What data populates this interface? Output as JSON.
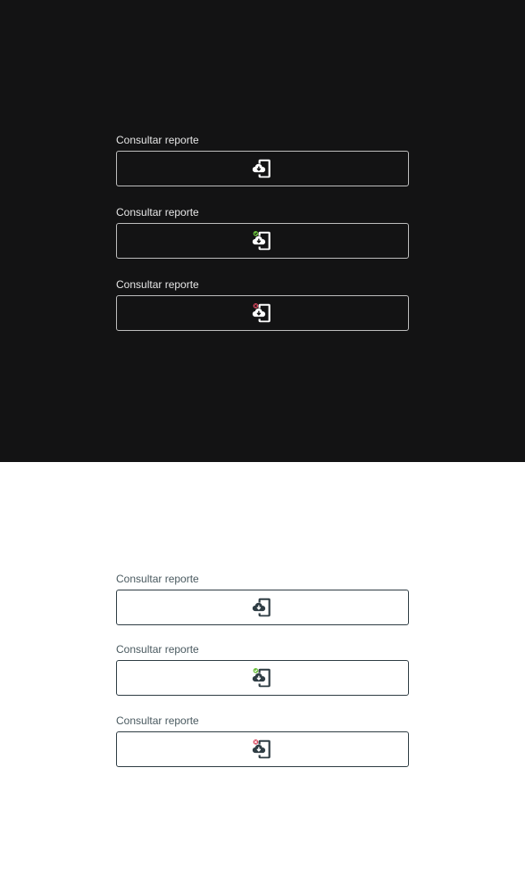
{
  "colors": {
    "dark_background": "#131314",
    "light_background": "#ffffff",
    "dark_icon": "#ffffff",
    "light_icon": "#2f3d44",
    "status_success": "#6abf3c",
    "status_error": "#d9485f"
  },
  "dark_panel": {
    "fields": [
      {
        "label": "Consultar reporte",
        "icon": "cloud-device-sync-icon",
        "status": "none"
      },
      {
        "label": "Consultar reporte",
        "icon": "cloud-device-sync-icon",
        "status": "success"
      },
      {
        "label": "Consultar reporte",
        "icon": "cloud-device-sync-icon",
        "status": "error"
      }
    ]
  },
  "light_panel": {
    "fields": [
      {
        "label": "Consultar reporte",
        "icon": "cloud-device-sync-icon",
        "status": "none"
      },
      {
        "label": "Consultar reporte",
        "icon": "cloud-device-sync-icon",
        "status": "success"
      },
      {
        "label": "Consultar reporte",
        "icon": "cloud-device-sync-icon",
        "status": "error"
      }
    ]
  }
}
